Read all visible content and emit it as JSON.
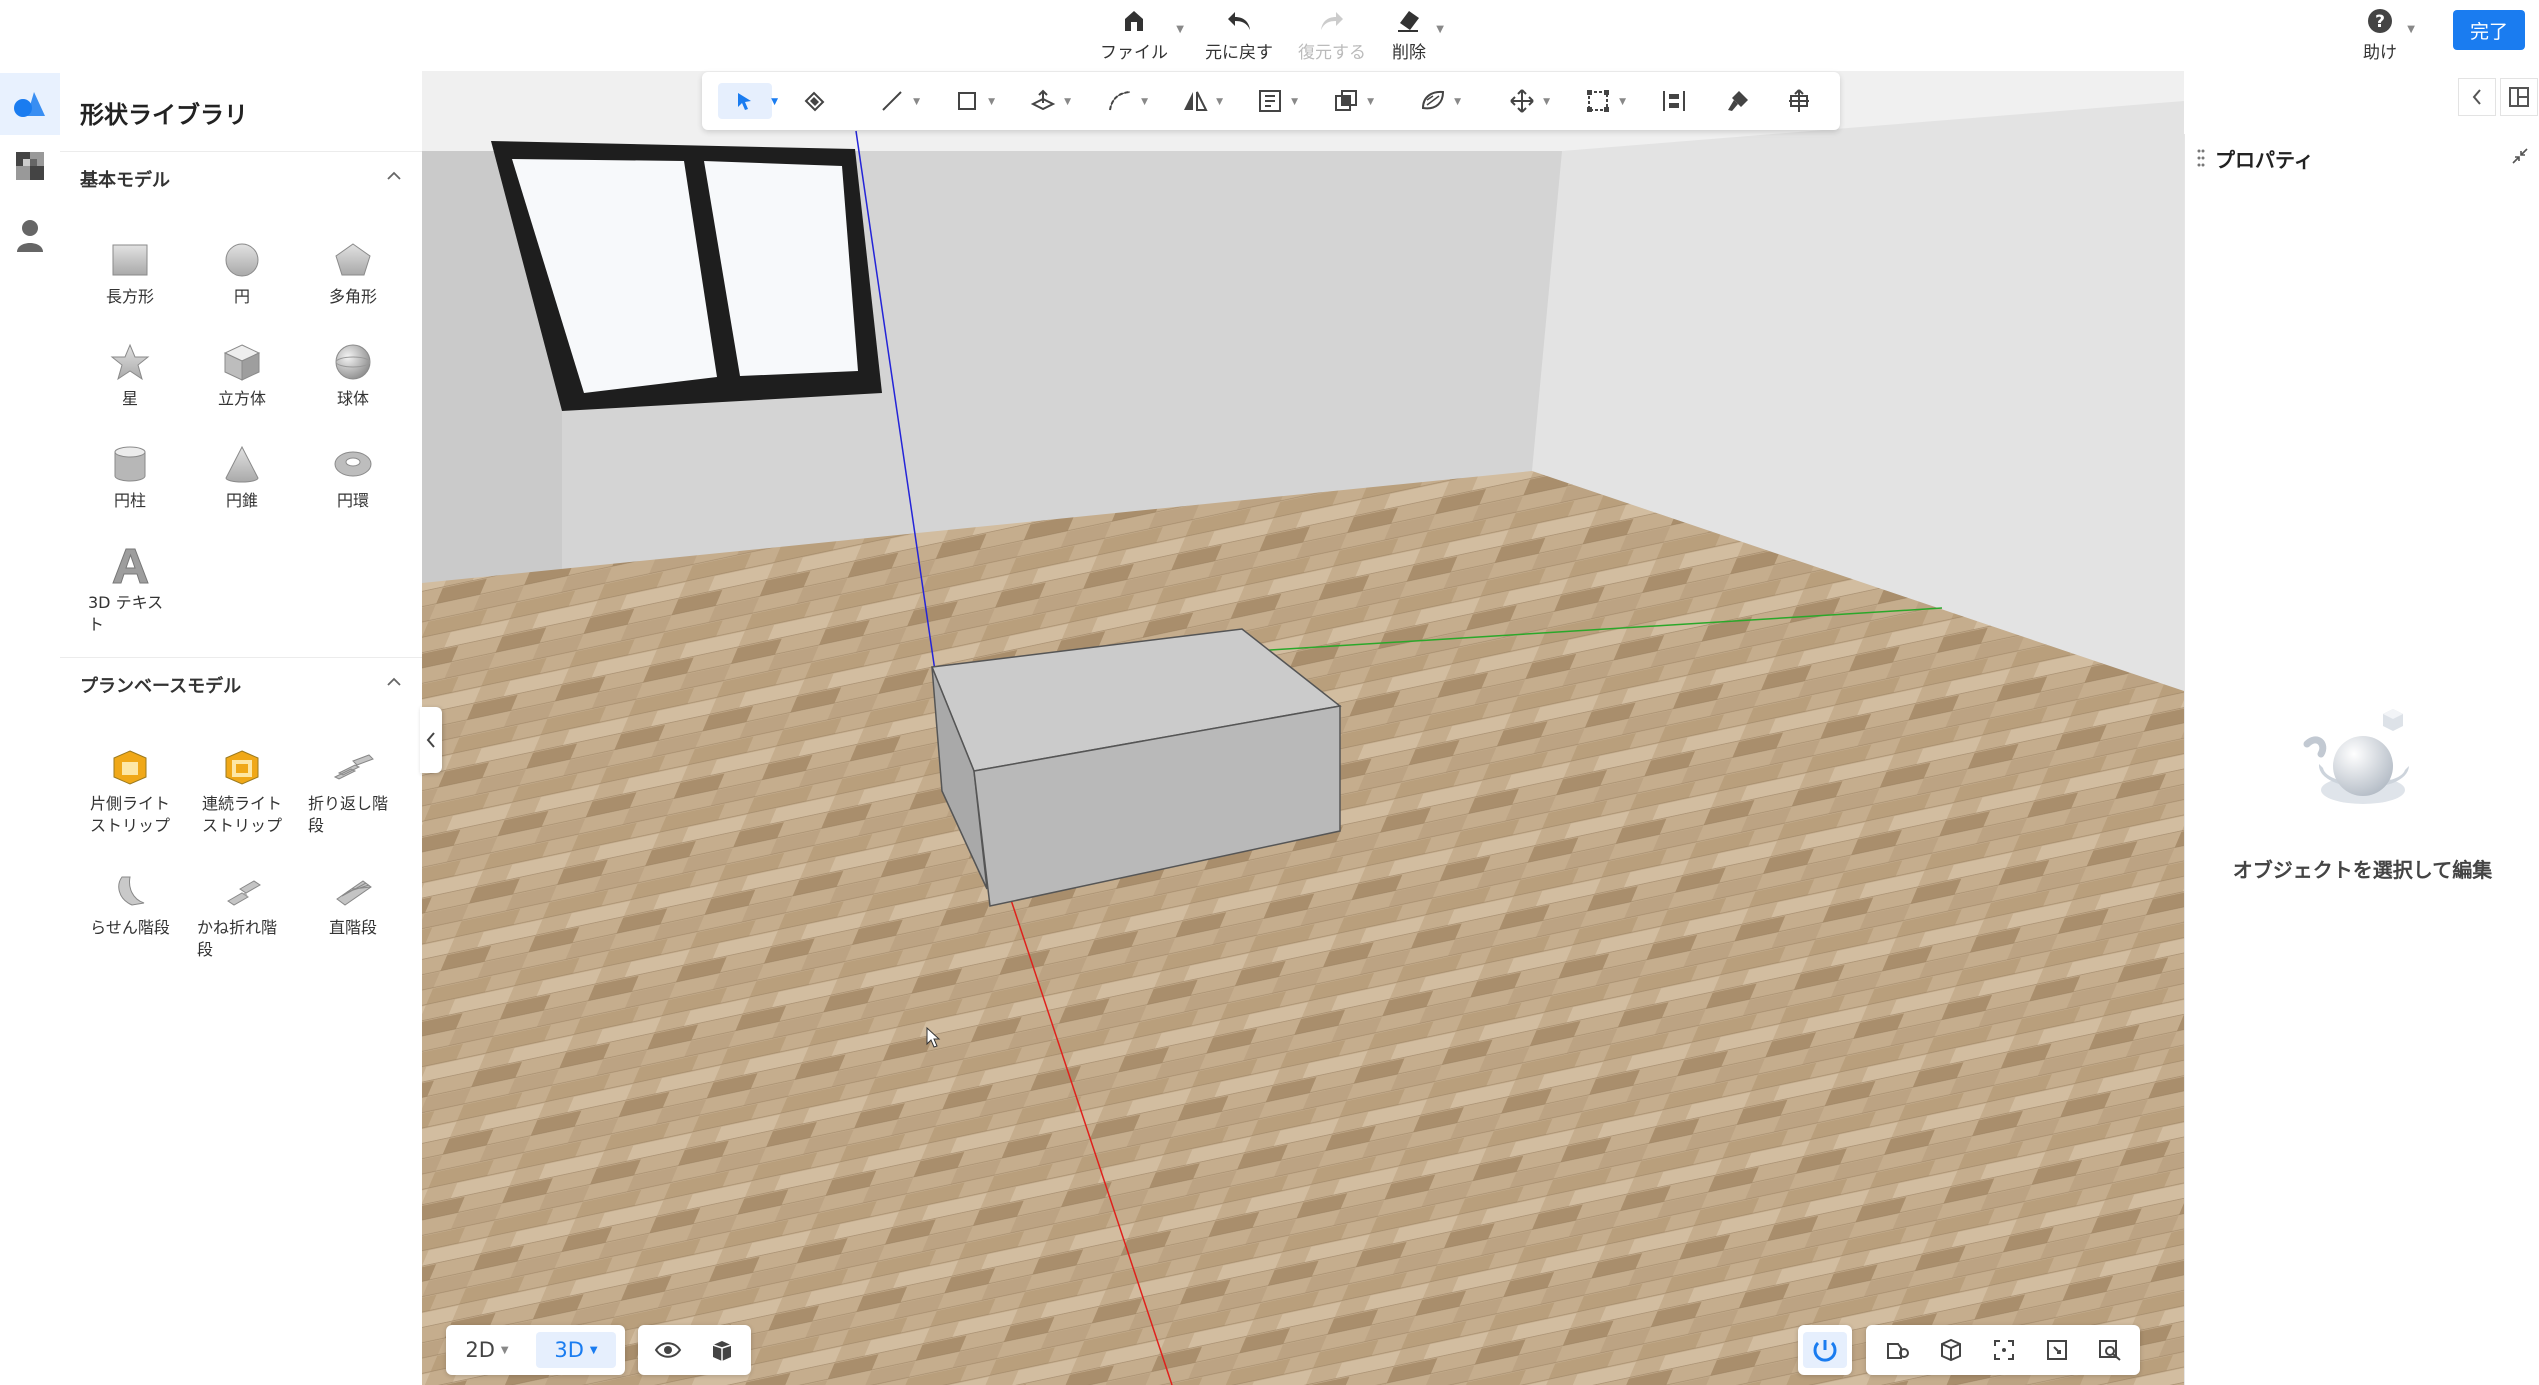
{
  "top_toolbar": {
    "file": "ファイル",
    "undo": "元に戻す",
    "redo": "復元する",
    "delete": "削除",
    "help": "助け",
    "done": "完了"
  },
  "library": {
    "title": "形状ライブラリ",
    "basic_section": "基本モデル",
    "basic_items": [
      "長方形",
      "円",
      "多角形",
      "星",
      "立方体",
      "球体",
      "円柱",
      "円錐",
      "円環",
      "3D テキスト"
    ],
    "plan_section": "プランベースモデル",
    "plan_items": [
      "片側ライトストリップ",
      "連続ライトストリップ",
      "折り返し階段",
      "らせん階段",
      "かね折れ階段",
      "直階段"
    ]
  },
  "properties": {
    "title": "プロパティ",
    "empty_message": "オブジェクトを選択して編集"
  },
  "bottom_bar": {
    "view_2d": "2D",
    "view_3d": "3D"
  },
  "colors": {
    "accent": "#1a7cf0",
    "x_axis": "#e0201c",
    "y_axis": "#2aa82a",
    "z_axis": "#2424d8",
    "floor": "#c3ab8b"
  },
  "icons": {
    "tools": [
      "select-arrow-icon",
      "paint-bucket-icon",
      "line-icon",
      "rectangle-icon",
      "push-pull-icon",
      "arc-icon",
      "mirror-icon",
      "offset-icon",
      "boolean-icon",
      "texture-icon",
      "move-icon",
      "scale-icon",
      "align-icon",
      "paint-icon",
      "rotate-icon"
    ]
  }
}
